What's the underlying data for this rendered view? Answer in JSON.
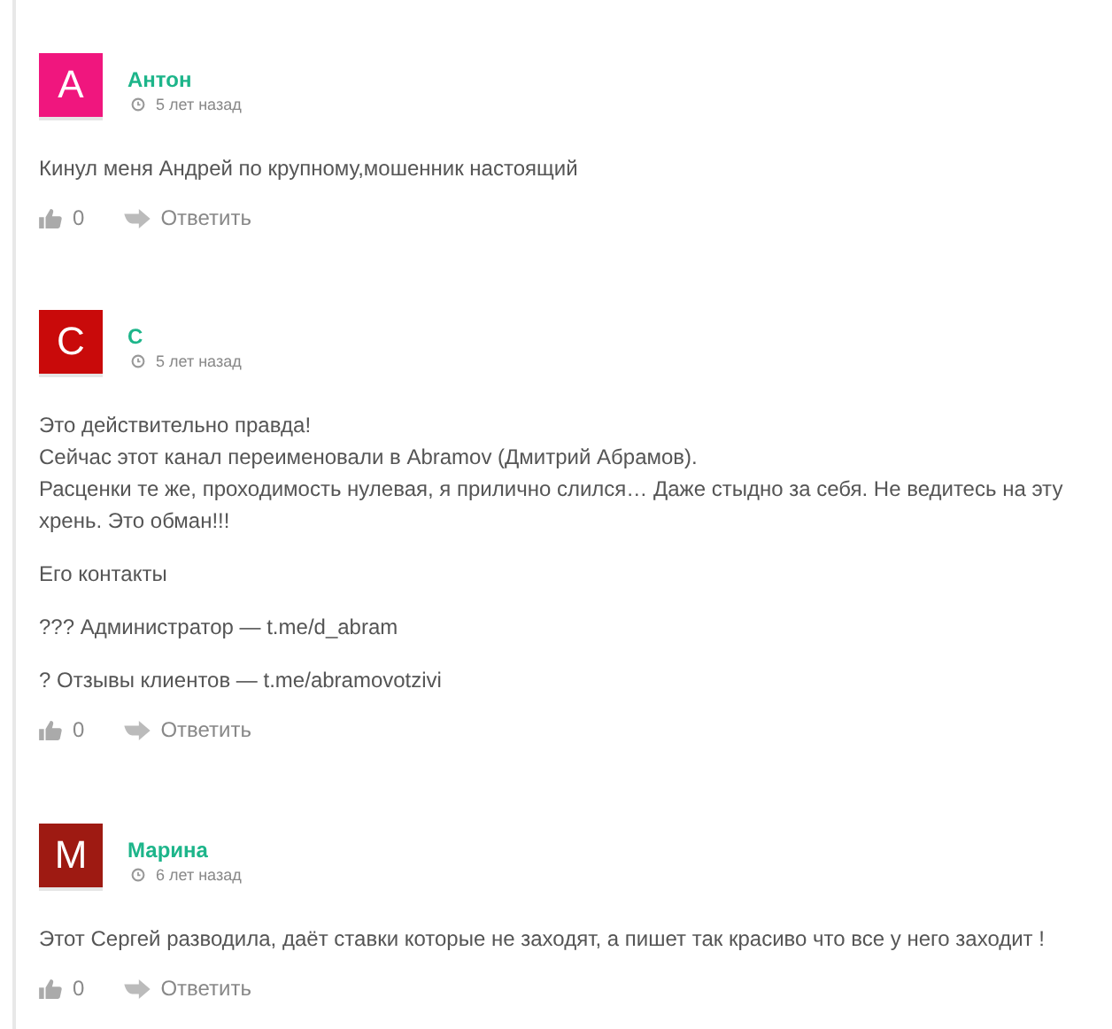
{
  "comments": [
    {
      "initial": "А",
      "color": "#f0167e",
      "author": "Антон",
      "time": "5 лет назад",
      "paragraphs": [
        "Кинул меня Андрей по крупному,мошенник настоящий"
      ],
      "likes": "0",
      "reply": "Ответить"
    },
    {
      "initial": "С",
      "color": "#c90a0a",
      "author": "С",
      "time": "5 лет назад",
      "paragraphs": [
        "Это действительно правда!\nСейчас этот канал переименовали в Abramov (Дмитрий Абрамов).\nРасценки те же, проходимость нулевая, я прилично слился… Даже стыдно за себя. Не ведитесь на эту хрень. Это обман!!!",
        "Его контакты",
        "??? Администратор — t.me/d_abram",
        "? Отзывы клиентов — t.me/abramovotzivi"
      ],
      "likes": "0",
      "reply": "Ответить"
    },
    {
      "initial": "М",
      "color": "#9e1a12",
      "author": "Марина",
      "time": "6 лет назад",
      "paragraphs": [
        "Этот Сергей разводила, даёт ставки которые не заходят, а пишет так красиво что все у него заходит !"
      ],
      "likes": "0",
      "reply": "Ответить"
    }
  ]
}
